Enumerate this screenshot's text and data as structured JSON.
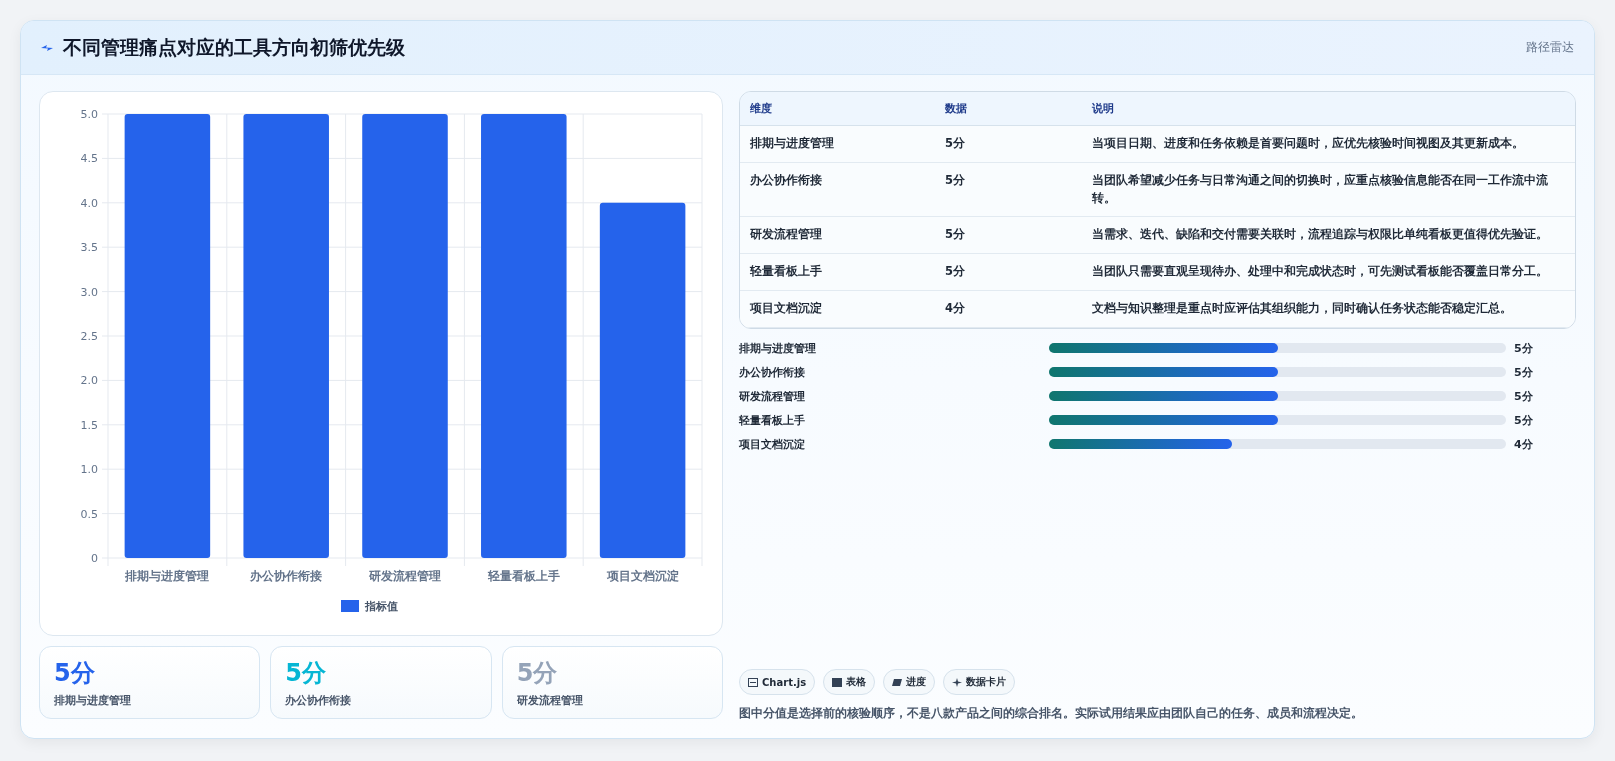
{
  "header": {
    "title": "不同管理痛点对应的工具方向初筛优先级",
    "tag": "路径雷达"
  },
  "chart": {
    "chart_data": {
      "type": "bar",
      "categories": [
        "排期与进度管理",
        "办公协作衔接",
        "研发流程管理",
        "轻量看板上手",
        "项目文档沉淀"
      ],
      "series": [
        {
          "name": "指标值",
          "color": "#2563eb",
          "values": [
            5,
            5,
            5,
            5,
            4
          ]
        }
      ],
      "ylim": [
        0,
        5
      ],
      "grid": true,
      "yticks": [
        {
          "value": 0,
          "label": "0"
        },
        0.5,
        {
          "value": 1,
          "label": "1.0"
        },
        1.5,
        {
          "value": 2,
          "label": "2.0"
        },
        2.5,
        {
          "value": 3,
          "label": "3.0"
        },
        3.5,
        {
          "value": 4,
          "label": "4.0"
        },
        4.5,
        {
          "value": 5,
          "label": "5.0"
        }
      ]
    }
  },
  "table": {
    "columns": [
      "维度",
      "数据",
      "说明"
    ],
    "rows": [
      [
        "排期与进度管理",
        "5分",
        "当项目日期、进度和任务依赖是首要问题时，应优先核验时间视图及其更新成本。"
      ],
      [
        "办公协作衔接",
        "5分",
        "当团队希望减少任务与日常沟通之间的切换时，应重点核验信息能否在同一工作流中流转。"
      ],
      [
        "研发流程管理",
        "5分",
        "当需求、迭代、缺陷和交付需要关联时，流程追踪与权限比单纯看板更值得优先验证。"
      ],
      [
        "轻量看板上手",
        "5分",
        "当团队只需要直观呈现待办、处理中和完成状态时，可先测试看板能否覆盖日常分工。"
      ],
      [
        "项目文档沉淀",
        "4分",
        "文档与知识整理是重点时应评估其组织能力，同时确认任务状态能否稳定汇总。"
      ]
    ]
  },
  "progress": [
    {
      "label": "排期与进度管理",
      "level": 0.5,
      "value": "5分"
    },
    {
      "label": "办公协作衔接",
      "level": 0.5,
      "value": "5分"
    },
    {
      "label": "研发流程管理",
      "level": 0.5,
      "value": "5分"
    },
    {
      "label": "轻量看板上手",
      "level": 0.5,
      "value": "5分"
    },
    {
      "label": "项目文档沉淀",
      "level": 0.4,
      "value": "4分"
    }
  ],
  "cards": [
    {
      "value": "5分",
      "label": "排期与进度管理",
      "color": "#2563eb"
    },
    {
      "value": "5分",
      "label": "办公协作衔接",
      "color": "#06b6d4"
    },
    {
      "value": "5分",
      "label": "研发流程管理",
      "color": "#94a3b8"
    }
  ],
  "chips": [
    {
      "kind": "chart",
      "label": "Chart.js"
    },
    {
      "kind": "table",
      "label": "表格"
    },
    {
      "kind": "progress",
      "label": "进度"
    },
    {
      "kind": "card",
      "label": "数据卡片"
    }
  ],
  "note": "图中分值是选择前的核验顺序，不是八款产品之间的综合排名。实际试用结果应由团队自己的任务、成员和流程决定。"
}
